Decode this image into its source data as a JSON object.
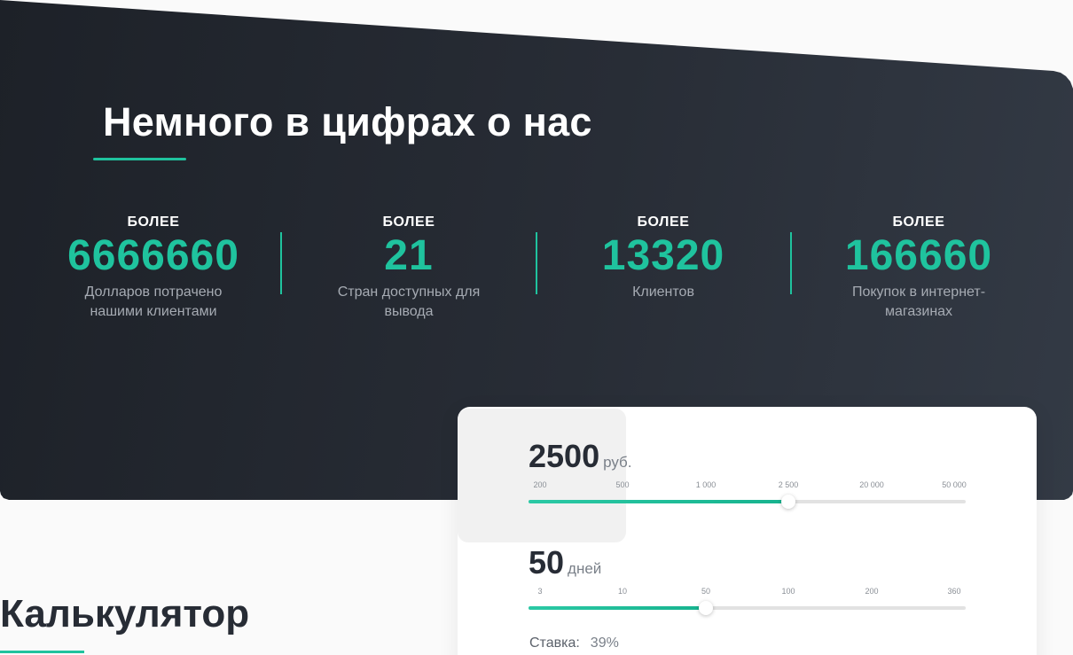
{
  "stats": {
    "title": "Немного в цифрах о нас",
    "items": [
      {
        "prefix": "БОЛЕЕ",
        "value": "6666660",
        "caption": "Долларов потрачено нашими клиентами"
      },
      {
        "prefix": "БОЛЕЕ",
        "value": "21",
        "caption": "Стран доступных для вывода"
      },
      {
        "prefix": "БОЛЕЕ",
        "value": "13320",
        "caption": "Клиентов"
      },
      {
        "prefix": "БОЛЕЕ",
        "value": "166660",
        "caption": "Покупок в интернет-магазинах"
      }
    ]
  },
  "calculator": {
    "title": "Калькулятор",
    "amount": {
      "value": "2500",
      "unit": "руб.",
      "ticks": [
        "200",
        "500",
        "1 000",
        "2 500",
        "20 000",
        "50 000"
      ],
      "fraction": 0.595
    },
    "days": {
      "value": "50",
      "unit": "дней",
      "ticks": [
        "3",
        "10",
        "50",
        "100",
        "200",
        "360"
      ],
      "fraction": 0.405
    },
    "rate": {
      "label": "Ставка:",
      "value": "39%"
    }
  },
  "colors": {
    "accent": "#1fc39e",
    "dark": "#272c35",
    "caption": "#a6abb3"
  }
}
